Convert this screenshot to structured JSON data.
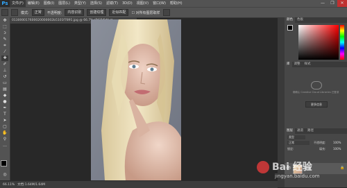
{
  "app": {
    "logo": "Ps"
  },
  "menu": {
    "items": [
      "文件(F)",
      "编辑(E)",
      "图像(I)",
      "图层(L)",
      "类型(Y)",
      "选择(S)",
      "滤镜(T)",
      "3D(D)",
      "视图(V)",
      "窗口(W)",
      "帮助(H)"
    ]
  },
  "window_controls": {
    "minimize": "—",
    "restore": "❐",
    "close": "✕"
  },
  "options": {
    "feather_label": "模式:",
    "mode_value": "正常",
    "opacity_label": "不透明度:",
    "flow_label": "流量:",
    "button_content_aware": "内容识别",
    "button_create_texture": "创建纹理",
    "button_proximity": "近似匹配",
    "checkbox_sample_all": "对所有图层取样"
  },
  "document": {
    "tab_label": "013000017600020000002b5101f7891.jpg @ 66.7% (RGB/8#) ✕"
  },
  "status": {
    "zoom": "66.11%",
    "doc_info": "文档:1.64M/1.64M"
  },
  "panels": {
    "color_tabs": [
      "颜色",
      "色板"
    ],
    "cc_tabs": [
      "库",
      "调整",
      "样式"
    ],
    "cc_message": "请确认 Creative Cloud Libraries 已登录",
    "cc_button": "更多信息",
    "layers_tabs": [
      "图层",
      "通道",
      "路径"
    ],
    "layer_kind": "类型",
    "layer_mode": "正常",
    "layer_opacity_label": "不透明度:",
    "layer_opacity_value": "100%",
    "layer_lock_label": "锁定:",
    "layer_fill_label": "填充:",
    "layer_fill_value": "100%",
    "layer_name": "背景"
  },
  "watermark": {
    "brand": "Bai 经验",
    "url": "jingyan.baidu.com"
  },
  "colors": {
    "accent": "#31a8ff",
    "foreground": "#000000",
    "background": "#ffffff",
    "picker_hue": "#ff0000"
  }
}
